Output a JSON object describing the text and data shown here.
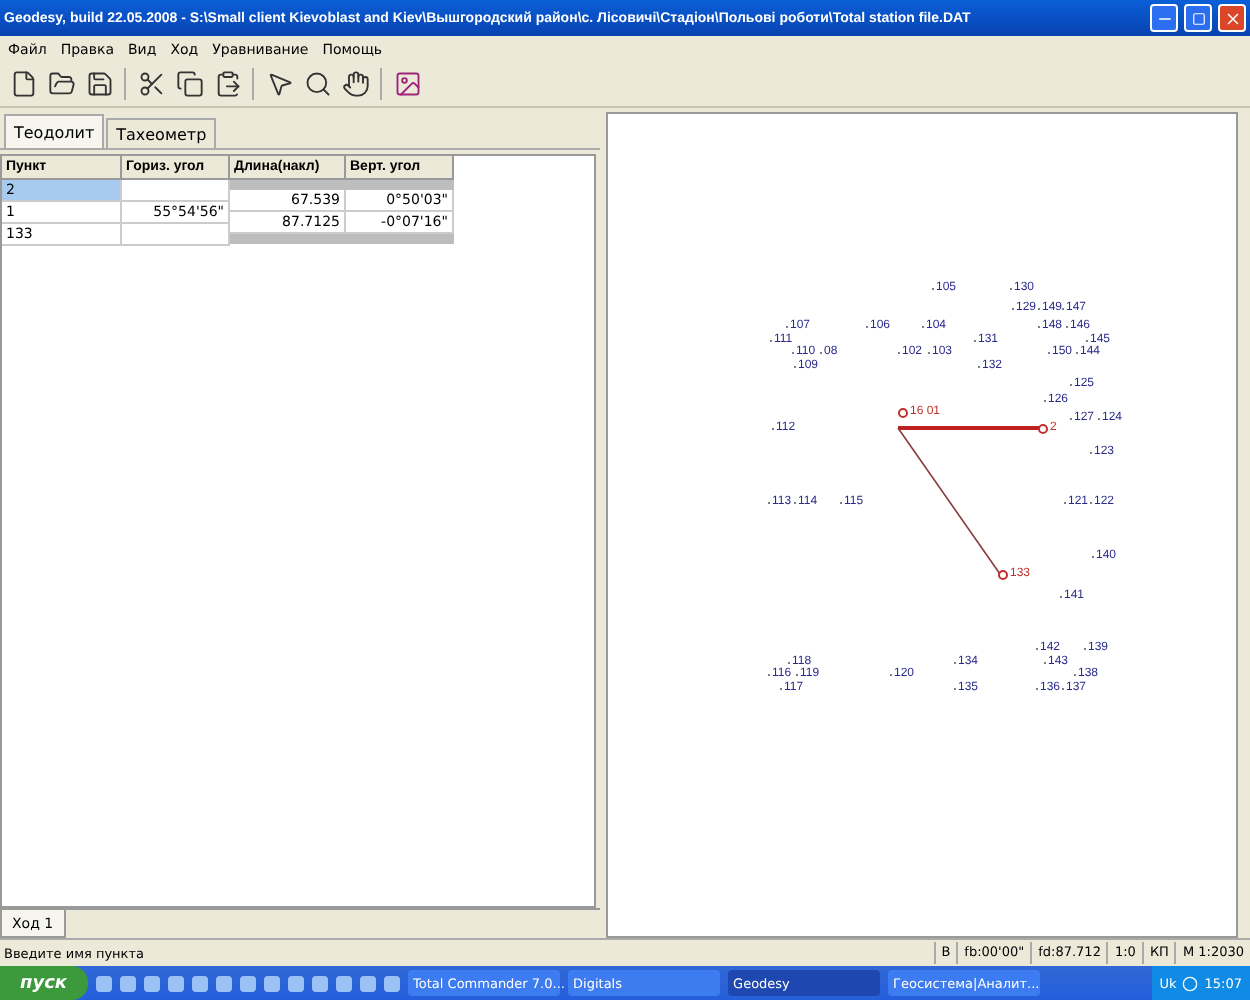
{
  "window": {
    "title": "Geodesy, build 22.05.2008 - S:\\Small client Kievoblast and Kiev\\Вышгородский район\\с. Лісовичі\\Стадіон\\Польові роботи\\Total station file.DAT"
  },
  "menu": [
    "Файл",
    "Правка",
    "Вид",
    "Ход",
    "Уравнивание",
    "Помощь"
  ],
  "tabs": [
    {
      "label": "Теодолит",
      "selected": true
    },
    {
      "label": "Тахеометр",
      "selected": false
    }
  ],
  "table": {
    "columns": [
      "Пункт",
      "Гориз. угол",
      "Длина(накл)",
      "Верт. угол"
    ],
    "stations": [
      {
        "point": "2",
        "selected": true
      },
      {
        "point": "1",
        "angle": "55°54'56\"",
        "selected": false
      },
      {
        "point": "133",
        "selected": false
      }
    ],
    "legs": [
      {
        "length": "67.539",
        "vertical": "0°50'03\""
      },
      {
        "length": "87.7125",
        "vertical": "-0°07'16\""
      }
    ]
  },
  "bottom_tabs": [
    {
      "label": "Ход 1",
      "selected": true
    }
  ],
  "points": [
    {
      "label": "105",
      "kind": "point"
    },
    {
      "label": "130",
      "kind": "point"
    },
    {
      "label": "129",
      "kind": "point"
    },
    {
      "label": "149",
      "kind": "point"
    },
    {
      "label": "147",
      "kind": "point"
    },
    {
      "label": "107",
      "kind": "point"
    },
    {
      "label": "106",
      "kind": "point"
    },
    {
      "label": "104",
      "kind": "point"
    },
    {
      "label": "148",
      "kind": "point"
    },
    {
      "label": "146",
      "kind": "point"
    },
    {
      "label": "111",
      "kind": "point"
    },
    {
      "label": "131",
      "kind": "point"
    },
    {
      "label": "145",
      "kind": "point"
    },
    {
      "label": "110",
      "kind": "point"
    },
    {
      "label": "08",
      "kind": "point"
    },
    {
      "label": "102",
      "kind": "point"
    },
    {
      "label": "103",
      "kind": "point"
    },
    {
      "label": "150",
      "kind": "point"
    },
    {
      "label": "144",
      "kind": "point"
    },
    {
      "label": "109",
      "kind": "point"
    },
    {
      "label": "132",
      "kind": "point"
    },
    {
      "label": "125",
      "kind": "point"
    },
    {
      "label": "126",
      "kind": "point"
    },
    {
      "label": "16 01",
      "kind": "station"
    },
    {
      "label": "127",
      "kind": "point"
    },
    {
      "label": "124",
      "kind": "point"
    },
    {
      "label": "112",
      "kind": "point"
    },
    {
      "label": "2",
      "kind": "target"
    },
    {
      "label": "123",
      "kind": "point"
    },
    {
      "label": "113",
      "kind": "point"
    },
    {
      "label": "114",
      "kind": "point"
    },
    {
      "label": "115",
      "kind": "point"
    },
    {
      "label": "121",
      "kind": "point"
    },
    {
      "label": "122",
      "kind": "point"
    },
    {
      "label": "140",
      "kind": "point"
    },
    {
      "label": "133",
      "kind": "target"
    },
    {
      "label": "141",
      "kind": "point"
    },
    {
      "label": "142",
      "kind": "point"
    },
    {
      "label": "139",
      "kind": "point"
    },
    {
      "label": "118",
      "kind": "point"
    },
    {
      "label": "134",
      "kind": "point"
    },
    {
      "label": "143",
      "kind": "point"
    },
    {
      "label": "116",
      "kind": "point"
    },
    {
      "label": "119",
      "kind": "point"
    },
    {
      "label": "120",
      "kind": "point"
    },
    {
      "label": "138",
      "kind": "point"
    },
    {
      "label": "117",
      "kind": "point"
    },
    {
      "label": "135",
      "kind": "point"
    },
    {
      "label": "136",
      "kind": "point"
    },
    {
      "label": "137",
      "kind": "point"
    }
  ],
  "status_bar": {
    "message": "Введите имя пункта",
    "fields": [
      "B",
      "fb:00'00\"",
      "fd:87.712",
      "1:0",
      "КП",
      "М 1:2030"
    ]
  },
  "taskbar": {
    "start": "пуск",
    "tasks": [
      {
        "label": "Total Commander 7.0...",
        "selected": false
      },
      {
        "label": "Digitals",
        "selected": false
      },
      {
        "label": "Geodesy",
        "selected": true
      },
      {
        "label": "Геосистема|Аналит...",
        "selected": false
      }
    ],
    "language": "Uk",
    "clock": "15:07"
  }
}
